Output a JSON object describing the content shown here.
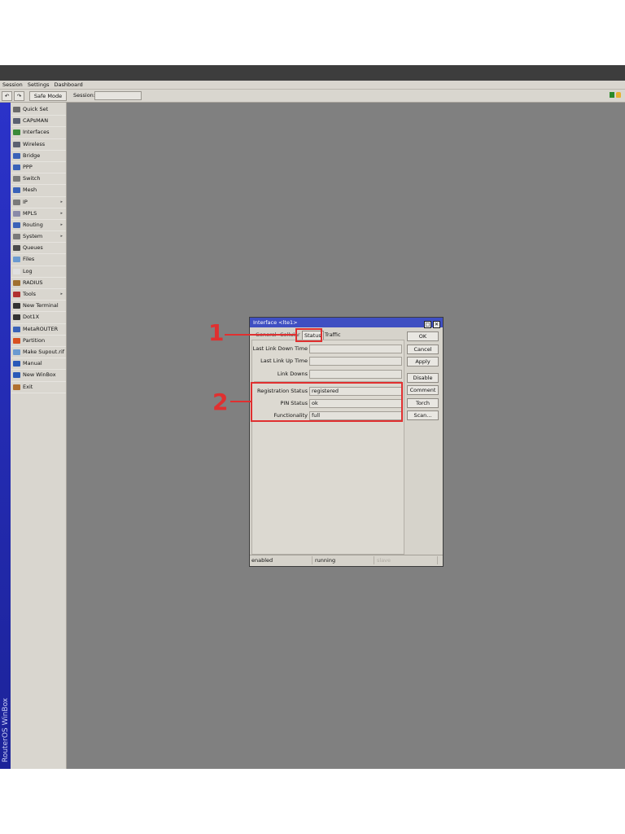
{
  "menubar": [
    "Session",
    "Settings",
    "Dashboard"
  ],
  "toolbar": {
    "safe_mode": "Safe Mode",
    "session_label": "Session:"
  },
  "sidebar": {
    "brand": "RouterOS WinBox",
    "items": [
      {
        "label": "Quick Set",
        "icon": "quickset-icon",
        "color": "#6a6a6a",
        "sub": false
      },
      {
        "label": "CAPsMAN",
        "icon": "antenna-icon",
        "color": "#5a6070",
        "sub": false
      },
      {
        "label": "Interfaces",
        "icon": "interfaces-icon",
        "color": "#3a8a3a",
        "sub": false
      },
      {
        "label": "Wireless",
        "icon": "wireless-icon",
        "color": "#5a6070",
        "sub": false
      },
      {
        "label": "Bridge",
        "icon": "bridge-icon",
        "color": "#3a62b8",
        "sub": false
      },
      {
        "label": "PPP",
        "icon": "ppp-icon",
        "color": "#3a62b8",
        "sub": false
      },
      {
        "label": "Switch",
        "icon": "switch-icon",
        "color": "#7a7a7a",
        "sub": false
      },
      {
        "label": "Mesh",
        "icon": "mesh-icon",
        "color": "#3a62b8",
        "sub": false
      },
      {
        "label": "IP",
        "icon": "ip-icon",
        "color": "#7a7a7a",
        "sub": true
      },
      {
        "label": "MPLS",
        "icon": "mpls-icon",
        "color": "#8a8aa8",
        "sub": true
      },
      {
        "label": "Routing",
        "icon": "routing-icon",
        "color": "#3a62b8",
        "sub": true
      },
      {
        "label": "System",
        "icon": "system-icon",
        "color": "#7a7a7a",
        "sub": true
      },
      {
        "label": "Queues",
        "icon": "queues-icon",
        "color": "#4a4a4a",
        "sub": false
      },
      {
        "label": "Files",
        "icon": "files-icon",
        "color": "#6a9ad0",
        "sub": false
      },
      {
        "label": "Log",
        "icon": "log-icon",
        "color": "#e0e0e0",
        "sub": false
      },
      {
        "label": "RADIUS",
        "icon": "radius-icon",
        "color": "#a07030",
        "sub": false
      },
      {
        "label": "Tools",
        "icon": "tools-icon",
        "color": "#b03030",
        "sub": true
      },
      {
        "label": "New Terminal",
        "icon": "terminal-icon",
        "color": "#333333",
        "sub": false
      },
      {
        "label": "Dot1X",
        "icon": "dot1x-icon",
        "color": "#333333",
        "sub": false
      },
      {
        "label": "MetaROUTER",
        "icon": "metarouter-icon",
        "color": "#3a62b8",
        "sub": false
      },
      {
        "label": "Partition",
        "icon": "partition-icon",
        "color": "#d85020",
        "sub": false
      },
      {
        "label": "Make Supout.rif",
        "icon": "supout-icon",
        "color": "#6a9ad0",
        "sub": false
      },
      {
        "label": "Manual",
        "icon": "manual-icon",
        "color": "#2a5ab8",
        "sub": false
      },
      {
        "label": "New WinBox",
        "icon": "winbox-icon",
        "color": "#2a5ab8",
        "sub": false
      },
      {
        "label": "Exit",
        "icon": "exit-icon",
        "color": "#b07030",
        "sub": false
      }
    ]
  },
  "dialog": {
    "title": "Interface <lte1>",
    "tabs": {
      "general": "General",
      "cellular": "Cellular",
      "status": "Status",
      "traffic": "Traffic"
    },
    "fields": [
      {
        "label": "Last Link Down Time",
        "value": ""
      },
      {
        "label": "Last Link Up Time",
        "value": ""
      },
      {
        "label": "Link Downs",
        "value": ""
      },
      {
        "label": "Registration Status",
        "value": "registered"
      },
      {
        "label": "PIN Status",
        "value": "ok"
      },
      {
        "label": "Functionality",
        "value": "full"
      }
    ],
    "buttons": [
      "OK",
      "Cancel",
      "Apply",
      "Disable",
      "Comment",
      "Torch",
      "Scan..."
    ],
    "status": [
      "enabled",
      "running",
      "slave"
    ]
  },
  "annotations": [
    "1",
    "2"
  ],
  "colors": {
    "accent_red": "#e03030",
    "titlebar_blue": "#3f4fc2"
  }
}
